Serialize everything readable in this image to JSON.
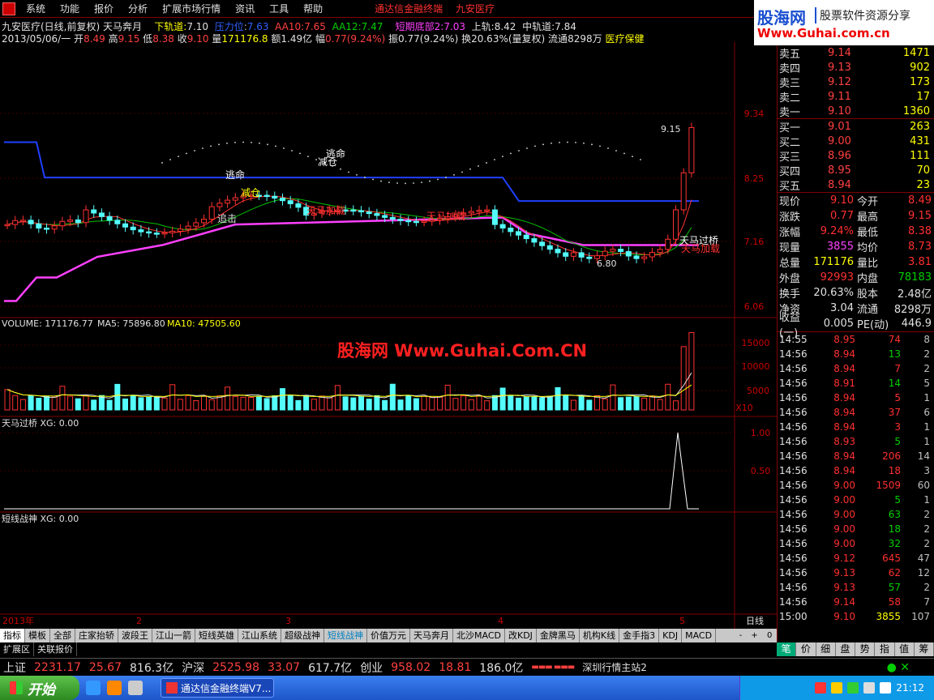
{
  "menu": {
    "items": [
      "系统",
      "功能",
      "报价",
      "分析",
      "扩展市场行情",
      "资讯",
      "工具",
      "帮助"
    ],
    "center_title": "通达信金融终端",
    "center_stock": "九安医疗"
  },
  "brand": {
    "logo": "股海网",
    "slogan": "股票软件资源分享",
    "url": "Www.Guhai.com.cn"
  },
  "chart": {
    "title_name": "九安医疗(日线,前复权)",
    "title_indicator": "天马奔月",
    "lower_track_label": "下轨道:",
    "lower_track": "7.10",
    "pressure_label": "压力位",
    "pressure": "7.63",
    "aa10_label": "AA10:",
    "aa10": "7.65",
    "aa12_label": "AA12:",
    "aa12": "7.47",
    "short_bottom_label": "短期底部2:",
    "short_bottom": "7.03",
    "upper_track_label": "上轨:",
    "upper_track": "8.42",
    "mid_track_label": "中轨道:",
    "mid_track": "7.84",
    "info_date": "2013/05/06/一",
    "info_open_label": "开",
    "info_open": "8.49",
    "info_high_label": "高",
    "info_high": "9.15",
    "info_low_label": "低",
    "info_low": "8.38",
    "info_close_label": "收",
    "info_close": "9.10",
    "info_vol_label": "量",
    "info_vol": "171176.8",
    "info_amt_label": "额",
    "info_amt": "1.49亿",
    "info_chg_label": "幅",
    "info_chg": "0.77(9.24%)",
    "info_amp_label": "振",
    "info_amp": "0.77(9.24%)",
    "info_turn_label": "换",
    "info_turn": "20.63%(量复权)",
    "info_float_label": "流通",
    "info_float": "8298万",
    "info_sector": "医疗保健",
    "y_ticks": [
      "9.34",
      "8.25",
      "7.16",
      "6.06"
    ],
    "peak_label": "9.15",
    "low_label": "6.80",
    "annotations": [
      "逃命",
      "减仓",
      "逃命",
      "减仓",
      "追击",
      "天马加载",
      "天马加载",
      "天马过桥",
      "天马加载"
    ],
    "watermark": "股海网 Www.Guhai.Com.CN",
    "volume_label": "VOLUME:",
    "volume": "171176.77",
    "ma5_label": "MA5:",
    "ma5": "75896.80",
    "ma10_label": "MA10:",
    "ma10": "47505.60",
    "vol_ticks": [
      "15000",
      "10000",
      "5000"
    ],
    "vol_unit": "X10",
    "ind1_label": "天马过桥",
    "ind1_xg": "XG: 0.00",
    "ind1_ticks": [
      "1.00",
      "0.50"
    ],
    "ind2_label": "短线战神",
    "ind2_xg": "XG: 0.00",
    "x_labels": [
      "2013年",
      "2",
      "3",
      "4",
      "5"
    ],
    "period": "日线",
    "colors": {
      "up": "#ff3030",
      "down": "#54fcfc",
      "ma_red": "#ff3030",
      "ma_green": "#00c000",
      "ma_yellow": "#ffff00",
      "band_blue": "#2040ff",
      "band_magenta": "#ff40ff"
    }
  },
  "chart_data": {
    "type": "candlestick",
    "title": "九安医疗(日线,前复权)",
    "x_labels": [
      "2013年",
      "2",
      "3",
      "4",
      "5"
    ],
    "ylim": [
      6.06,
      9.34
    ],
    "last": {
      "open": 8.49,
      "high": 9.15,
      "low": 8.38,
      "close": 9.1
    },
    "volume_last": 171176.77
  },
  "orderbook": {
    "asks": [
      {
        "label": "卖五",
        "price": "9.14",
        "vol": "1471"
      },
      {
        "label": "卖四",
        "price": "9.13",
        "vol": "902"
      },
      {
        "label": "卖三",
        "price": "9.12",
        "vol": "173"
      },
      {
        "label": "卖二",
        "price": "9.11",
        "vol": "17"
      },
      {
        "label": "卖一",
        "price": "9.10",
        "vol": "1360"
      }
    ],
    "bids": [
      {
        "label": "买一",
        "price": "9.01",
        "vol": "263"
      },
      {
        "label": "买二",
        "price": "9.00",
        "vol": "431"
      },
      {
        "label": "买三",
        "price": "8.96",
        "vol": "111"
      },
      {
        "label": "买四",
        "price": "8.95",
        "vol": "70"
      },
      {
        "label": "买五",
        "price": "8.94",
        "vol": "23"
      }
    ]
  },
  "quote": [
    {
      "l1": "现价",
      "v1": "9.10",
      "c1": "r",
      "l2": "今开",
      "v2": "8.49",
      "c2": "r"
    },
    {
      "l1": "涨跌",
      "v1": "0.77",
      "c1": "r",
      "l2": "最高",
      "v2": "9.15",
      "c2": "r"
    },
    {
      "l1": "涨幅",
      "v1": "9.24%",
      "c1": "r",
      "l2": "最低",
      "v2": "8.38",
      "c2": "r"
    },
    {
      "l1": "现量",
      "v1": "3855",
      "c1": "m",
      "l2": "均价",
      "v2": "8.73",
      "c2": "r"
    },
    {
      "l1": "总量",
      "v1": "171176",
      "c1": "y",
      "l2": "量比",
      "v2": "3.81",
      "c2": "r"
    },
    {
      "l1": "外盘",
      "v1": "92993",
      "c1": "r",
      "l2": "内盘",
      "v2": "78183",
      "c2": "g"
    },
    {
      "l1": "换手",
      "v1": "20.63%",
      "c1": "w",
      "l2": "股本",
      "v2": "2.48亿",
      "c2": "w"
    },
    {
      "l1": "净资",
      "v1": "3.04",
      "c1": "w",
      "l2": "流通",
      "v2": "8298万",
      "c2": "w"
    },
    {
      "l1": "收益(一)",
      "v1": "0.005",
      "c1": "w",
      "l2": "PE(动)",
      "v2": "446.9",
      "c2": "w"
    }
  ],
  "ticks": [
    {
      "t": "14:55",
      "p": "8.95",
      "v": "74",
      "n": "8",
      "pc": "r",
      "vc": "r"
    },
    {
      "t": "14:56",
      "p": "8.94",
      "v": "13",
      "n": "2",
      "pc": "r",
      "vc": "g"
    },
    {
      "t": "14:56",
      "p": "8.94",
      "v": "7",
      "n": "2",
      "pc": "r",
      "vc": "r"
    },
    {
      "t": "14:56",
      "p": "8.91",
      "v": "14",
      "n": "5",
      "pc": "r",
      "vc": "g"
    },
    {
      "t": "14:56",
      "p": "8.94",
      "v": "5",
      "n": "1",
      "pc": "r",
      "vc": "r"
    },
    {
      "t": "14:56",
      "p": "8.94",
      "v": "37",
      "n": "6",
      "pc": "r",
      "vc": "r"
    },
    {
      "t": "14:56",
      "p": "8.94",
      "v": "3",
      "n": "1",
      "pc": "r",
      "vc": "r"
    },
    {
      "t": "14:56",
      "p": "8.93",
      "v": "5",
      "n": "1",
      "pc": "r",
      "vc": "g"
    },
    {
      "t": "14:56",
      "p": "8.94",
      "v": "206",
      "n": "14",
      "pc": "r",
      "vc": "r"
    },
    {
      "t": "14:56",
      "p": "8.94",
      "v": "18",
      "n": "3",
      "pc": "r",
      "vc": "r"
    },
    {
      "t": "14:56",
      "p": "9.00",
      "v": "1509",
      "n": "60",
      "pc": "r",
      "vc": "r"
    },
    {
      "t": "14:56",
      "p": "9.00",
      "v": "5",
      "n": "1",
      "pc": "r",
      "vc": "g"
    },
    {
      "t": "14:56",
      "p": "9.00",
      "v": "63",
      "n": "2",
      "pc": "r",
      "vc": "g"
    },
    {
      "t": "14:56",
      "p": "9.00",
      "v": "18",
      "n": "2",
      "pc": "r",
      "vc": "g"
    },
    {
      "t": "14:56",
      "p": "9.00",
      "v": "32",
      "n": "2",
      "pc": "r",
      "vc": "g"
    },
    {
      "t": "14:56",
      "p": "9.12",
      "v": "645",
      "n": "47",
      "pc": "r",
      "vc": "r"
    },
    {
      "t": "14:56",
      "p": "9.13",
      "v": "62",
      "n": "12",
      "pc": "r",
      "vc": "r"
    },
    {
      "t": "14:56",
      "p": "9.13",
      "v": "57",
      "n": "2",
      "pc": "r",
      "vc": "g"
    },
    {
      "t": "14:56",
      "p": "9.14",
      "v": "58",
      "n": "7",
      "pc": "r",
      "vc": "r"
    },
    {
      "t": "15:00",
      "p": "9.10",
      "v": "3855",
      "n": "107",
      "pc": "r",
      "vc": "y"
    }
  ],
  "tabs": [
    "指标",
    "模板",
    "全部",
    "庄家抬轿",
    "波段王",
    "江山一箭",
    "短线英雄",
    "江山系统",
    "超级战神",
    "短线战神",
    "价值万元",
    "天马奔月",
    "北沙MACD",
    "改KDJ",
    "金牌黑马",
    "机构K线",
    "金手指3",
    "KDJ",
    "MACD"
  ],
  "active_tab": "指标",
  "subtabs": [
    "扩展区",
    "关联报价"
  ],
  "nav_buttons": [
    "-",
    "+",
    "0"
  ],
  "panel_tabs": [
    "笔",
    "价",
    "细",
    "盘",
    "势",
    "指",
    "值",
    "筹"
  ],
  "index_bar": {
    "sh_label": "上证",
    "sh": "2231.17",
    "sh_chg": "25.67",
    "sh_amt": "816.3亿",
    "hs_label": "沪深",
    "hs": "2525.98",
    "hs_chg": "33.07",
    "hs_amt": "617.7亿",
    "cy_label": "创业",
    "cy": "958.02",
    "cy_chg": "18.81",
    "cy_amt": "186.0亿",
    "server": "深圳行情主站2"
  },
  "taskbar": {
    "start": "开始",
    "item": "通达信金融终端V7...",
    "time": "21:12"
  }
}
